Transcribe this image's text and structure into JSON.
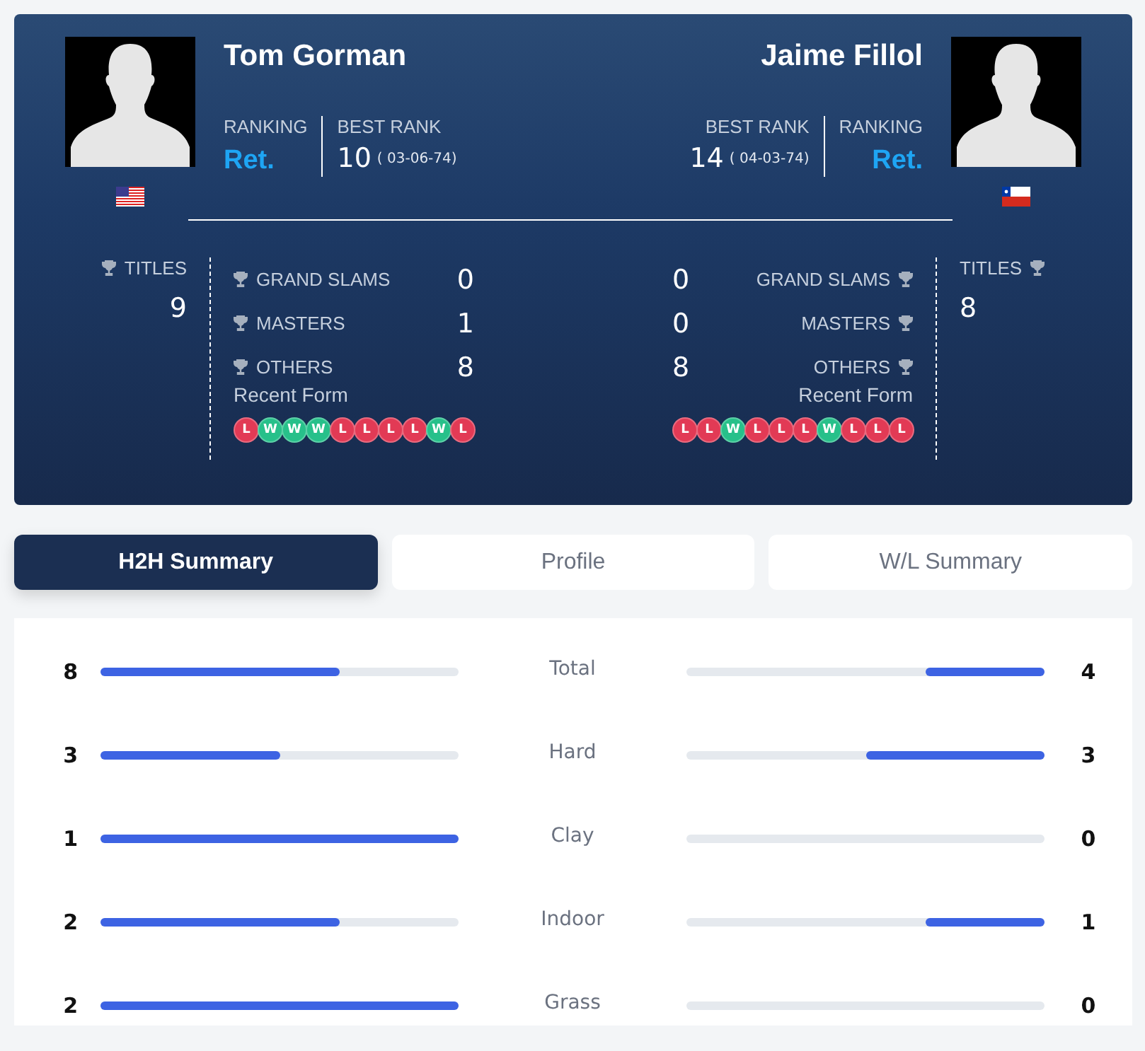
{
  "players": [
    {
      "name": "Tom Gorman",
      "flag": {
        "kind": "us"
      },
      "ranking_label": "RANKING",
      "ranking": "Ret.",
      "best_rank_label": "BEST RANK",
      "best_rank": "10",
      "best_rank_date": "( 03-06-74)",
      "titles_label": "TITLES",
      "titles": "9",
      "stats": [
        {
          "label": "GRAND SLAMS",
          "value": "0"
        },
        {
          "label": "MASTERS",
          "value": "1"
        },
        {
          "label": "OTHERS",
          "value": "8"
        }
      ],
      "form_label": "Recent Form",
      "form": [
        {
          "result": "L",
          "won": false
        },
        {
          "result": "W",
          "won": true
        },
        {
          "result": "W",
          "won": true
        },
        {
          "result": "W",
          "won": true
        },
        {
          "result": "L",
          "won": false
        },
        {
          "result": "L",
          "won": false
        },
        {
          "result": "L",
          "won": false
        },
        {
          "result": "L",
          "won": false
        },
        {
          "result": "W",
          "won": true
        },
        {
          "result": "L",
          "won": false
        }
      ]
    },
    {
      "name": "Jaime Fillol",
      "flag": {
        "kind": "cl"
      },
      "ranking_label": "RANKING",
      "ranking": "Ret.",
      "best_rank_label": "BEST RANK",
      "best_rank": "14",
      "best_rank_date": "( 04-03-74)",
      "titles_label": "TITLES",
      "titles": "8",
      "stats": [
        {
          "label": "GRAND SLAMS",
          "value": "0"
        },
        {
          "label": "MASTERS",
          "value": "0"
        },
        {
          "label": "OTHERS",
          "value": "8"
        }
      ],
      "form_label": "Recent Form",
      "form": [
        {
          "result": "L",
          "won": false
        },
        {
          "result": "L",
          "won": false
        },
        {
          "result": "W",
          "won": true
        },
        {
          "result": "L",
          "won": false
        },
        {
          "result": "L",
          "won": false
        },
        {
          "result": "L",
          "won": false
        },
        {
          "result": "W",
          "won": true
        },
        {
          "result": "L",
          "won": false
        },
        {
          "result": "L",
          "won": false
        },
        {
          "result": "L",
          "won": false
        }
      ]
    }
  ],
  "tabs": [
    {
      "label": "H2H Summary",
      "selected": true
    },
    {
      "label": "Profile",
      "selected": false
    },
    {
      "label": "W/L Summary",
      "selected": false
    }
  ],
  "summary": [
    {
      "label": "Total",
      "left": {
        "count": "8",
        "level": 0.667
      },
      "right": {
        "count": "4",
        "level": 0.333
      }
    },
    {
      "label": "Hard",
      "left": {
        "count": "3",
        "level": 0.5
      },
      "right": {
        "count": "3",
        "level": 0.5
      }
    },
    {
      "label": "Clay",
      "left": {
        "count": "1",
        "level": 1
      },
      "right": {
        "count": "0",
        "level": 0
      }
    },
    {
      "label": "Indoor",
      "left": {
        "count": "2",
        "level": 0.667
      },
      "right": {
        "count": "1",
        "level": 0.333
      }
    },
    {
      "label": "Grass",
      "left": {
        "count": "2",
        "level": 1
      },
      "right": {
        "count": "0",
        "level": 0
      }
    }
  ]
}
